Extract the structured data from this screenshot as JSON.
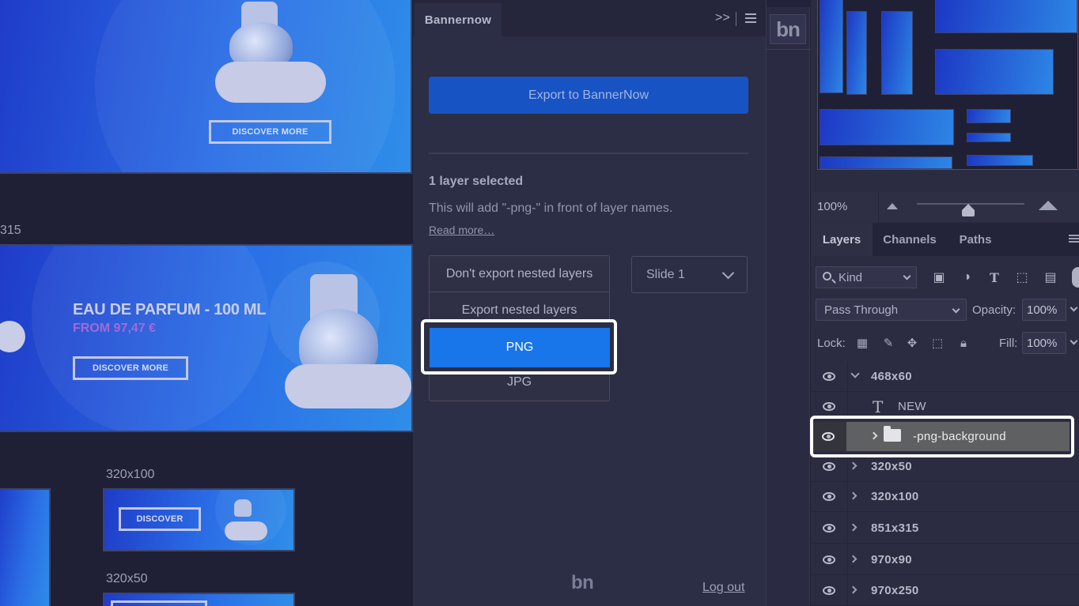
{
  "canvas": {
    "banner_top": {
      "button": "DISCOVER MORE"
    },
    "size_label_851": "315",
    "banner_wide": {
      "headline": "EAU DE PARFUM - 100 ML",
      "price": "FROM 97,47 €",
      "button": "DISCOVER MORE"
    },
    "size_label_320x100": "320x100",
    "banner_small": {
      "button": "DISCOVER"
    },
    "size_label_320x50": "320x50"
  },
  "plugin": {
    "tab_title": "Bannernow",
    "collapse_glyph": ">>",
    "export_button": "Export to BannerNow",
    "selection_title": "1 layer selected",
    "selection_desc": "This will add \"-png-\" in front of layer names.",
    "read_more": "Read more…",
    "dropdown_options": [
      "Don't export nested layers",
      "Export nested layers",
      "PNG",
      "JPG"
    ],
    "selected_option": "PNG",
    "slide_select": "Slide 1",
    "footer_logo": "bn",
    "logout": "Log out"
  },
  "toolstrip": {
    "logo": "bn"
  },
  "navigator": {
    "zoom": "100%"
  },
  "layers_panel": {
    "tabs": [
      "Layers",
      "Channels",
      "Paths"
    ],
    "active_tab": "Layers",
    "filter_kind": "Kind",
    "blend_mode": "Pass Through",
    "opacity_label": "Opacity:",
    "opacity": "100%",
    "lock_label": "Lock:",
    "fill_label": "Fill:",
    "fill": "100%",
    "layers": [
      {
        "name": "468x60",
        "type": "group",
        "expanded": true
      },
      {
        "name": "NEW",
        "type": "text"
      },
      {
        "name": "-png-background",
        "type": "group",
        "selected": true
      },
      {
        "name": "320x50",
        "type": "group"
      },
      {
        "name": "320x100",
        "type": "group"
      },
      {
        "name": "851x315",
        "type": "group"
      },
      {
        "name": "970x90",
        "type": "group"
      },
      {
        "name": "970x250",
        "type": "group"
      }
    ]
  },
  "colors": {
    "accent_blue": "#1876ea",
    "export_button": "#1853c4",
    "highlight_outline": "#ffffff"
  }
}
